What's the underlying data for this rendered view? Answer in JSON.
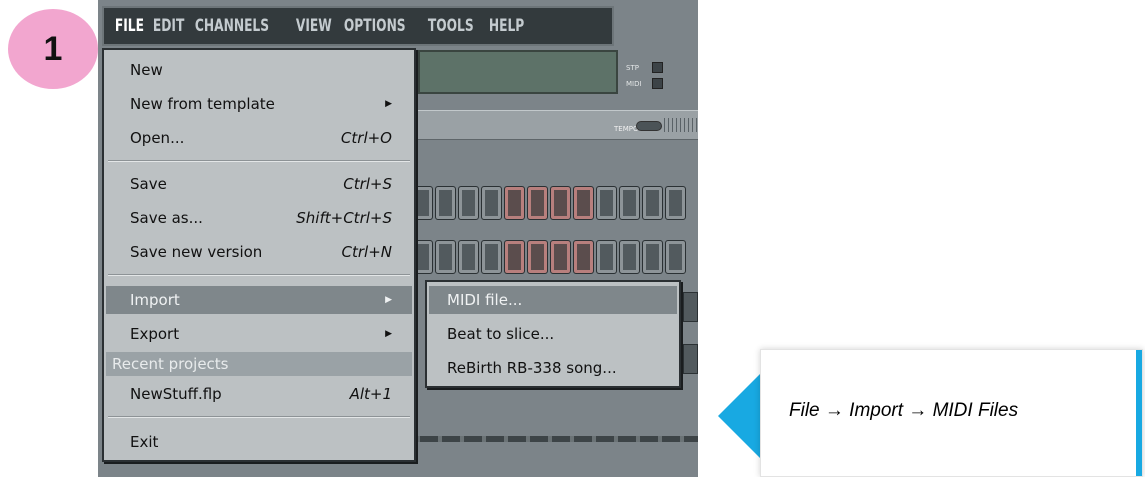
{
  "step_badge": "1",
  "menubar": {
    "items": [
      "FILE",
      "EDIT",
      "CHANNELS",
      "VIEW",
      "OPTIONS",
      "TOOLS",
      "HELP"
    ]
  },
  "panel_labels": {
    "stp": "STP",
    "midi": "MIDI",
    "tempo": "TEMPO"
  },
  "file_menu": {
    "new": "New",
    "new_from_template": "New from template",
    "open": "Open...",
    "open_shortcut": "Ctrl+O",
    "save": "Save",
    "save_shortcut": "Ctrl+S",
    "save_as": "Save as...",
    "save_as_shortcut": "Shift+Ctrl+S",
    "save_new_version": "Save new version",
    "save_new_version_shortcut": "Ctrl+N",
    "import": "Import",
    "export": "Export",
    "recent_projects_header": "Recent projects",
    "recent_file": "NewStuff.flp",
    "recent_file_shortcut": "Alt+1",
    "exit": "Exit"
  },
  "import_submenu": {
    "midi_file": "MIDI file...",
    "beat_to_slice": "Beat to slice...",
    "rebirth_song": "ReBirth RB-338 song..."
  },
  "callout": {
    "text": "File → Import → MIDI Files",
    "accent_color": "#18a9e2"
  },
  "colors": {
    "badge": "#f2a6cf",
    "menu_bg": "#bcc1c3",
    "highlight": "#7f878b"
  }
}
